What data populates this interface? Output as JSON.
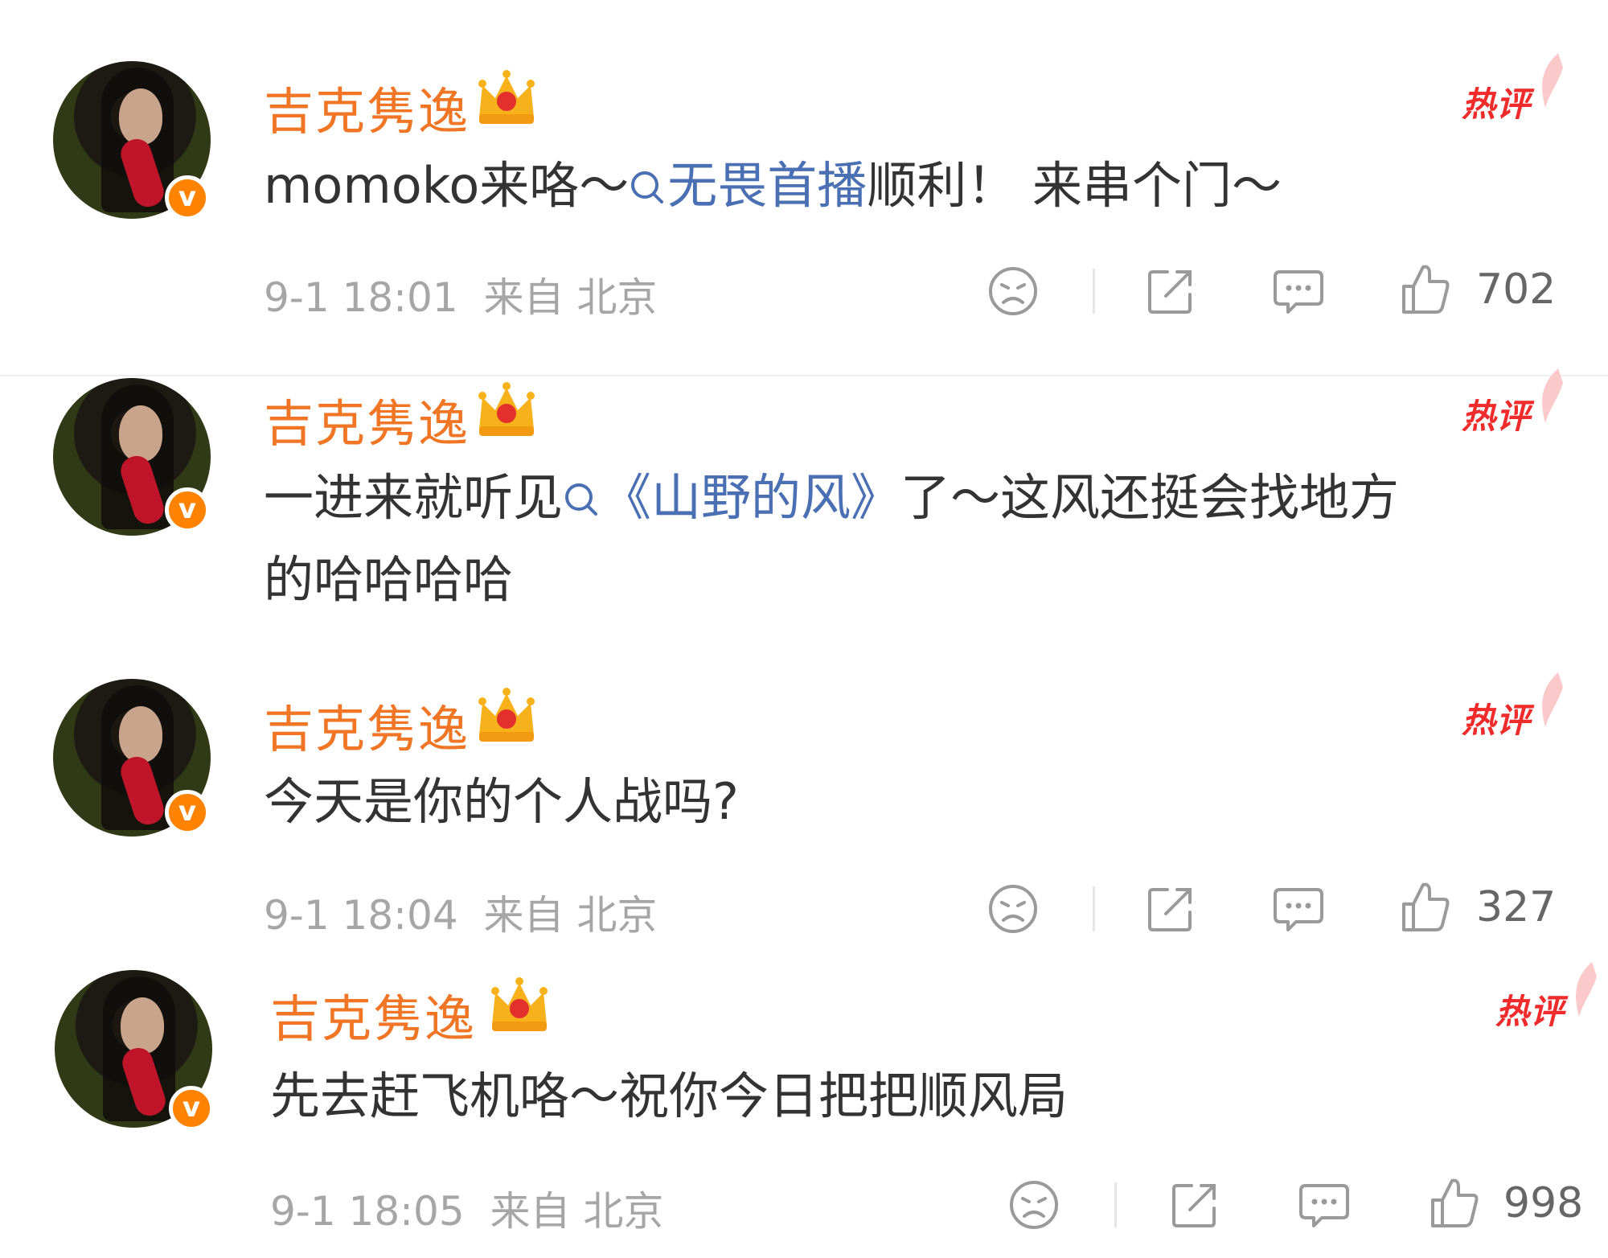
{
  "comments": [
    {
      "username": "吉克隽逸",
      "badge": "热评",
      "text_parts": [
        "momoko来咯～",
        "无畏首播",
        "顺利！ 来串个门～"
      ],
      "meta": {
        "time": "9-1 18:01",
        "source": "来自 北京"
      },
      "likes": "702"
    },
    {
      "username": "吉克隽逸",
      "badge": "热评",
      "text_parts": [
        "一进来就听见",
        "《山野的风》",
        "了～这风还挺会找地方"
      ],
      "text_line2": "的哈哈哈哈"
    },
    {
      "username": "吉克隽逸",
      "badge": "热评",
      "text": "今天是你的个人战吗?",
      "meta": {
        "time": "9-1 18:04",
        "source": "来自 北京"
      },
      "likes": "327"
    },
    {
      "username": "吉克隽逸",
      "badge": "热评",
      "text": "先去赶飞机咯～祝你今日把把顺风局",
      "meta": {
        "time": "9-1 18:05",
        "source": "来自 北京"
      },
      "likes": "998"
    }
  ],
  "icons": {
    "verified": "v",
    "crown": "crown-icon",
    "search": "search-icon",
    "dislike": "sad-face-icon",
    "share": "share-icon",
    "reply": "comment-icon",
    "like": "thumbs-up-icon"
  },
  "colors": {
    "username": "#f07524",
    "topic": "#4a6fb3",
    "hot_badge": "#f02b2b",
    "verified_badge": "#ff8200",
    "meta": "#a6a6a6"
  }
}
